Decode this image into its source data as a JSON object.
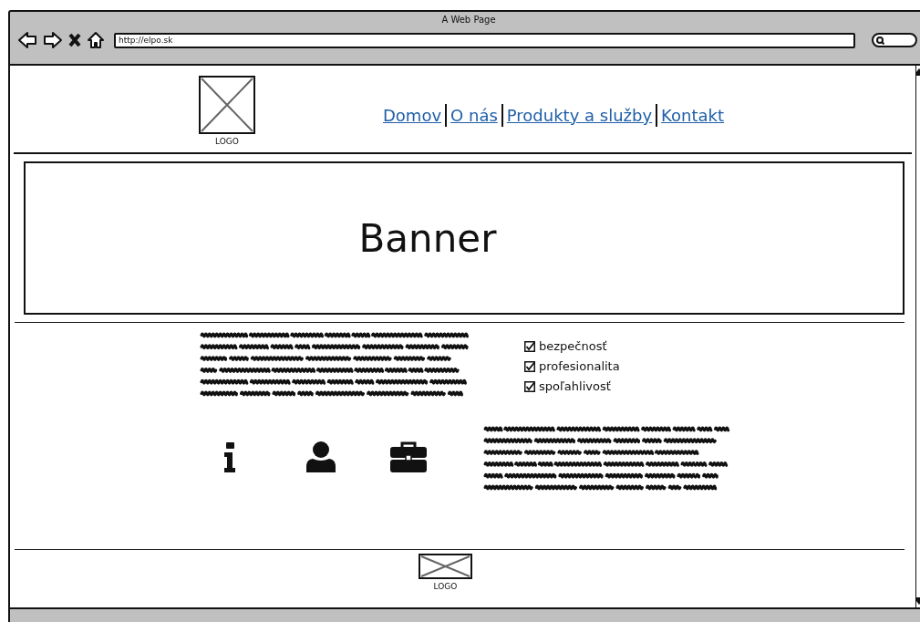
{
  "window": {
    "title": "A Web Page",
    "url": "http://elpo.sk"
  },
  "header": {
    "logo_label": "LOGO",
    "nav": [
      {
        "label": "Domov"
      },
      {
        "label": "O nás"
      },
      {
        "label": "Produkty a služby"
      },
      {
        "label": "Kontakt"
      }
    ]
  },
  "banner": {
    "title": "Banner"
  },
  "features": [
    {
      "label": "bezpečnosť",
      "checked": true
    },
    {
      "label": "profesionalita",
      "checked": true
    },
    {
      "label": "spoľahlivosť",
      "checked": true
    }
  ],
  "footer": {
    "logo_label": "LOGO"
  }
}
